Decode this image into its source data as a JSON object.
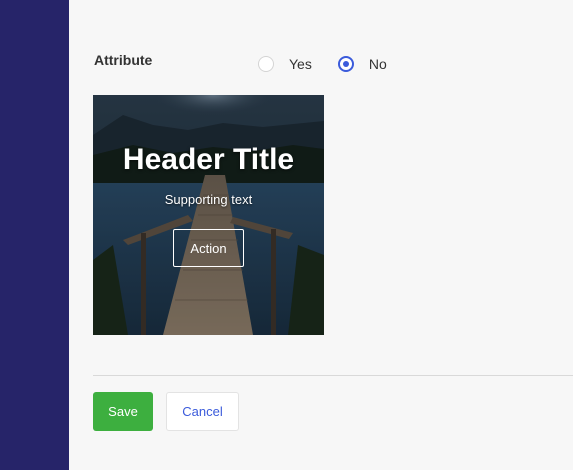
{
  "attribute": {
    "label": "Attribute",
    "options": [
      {
        "label": "Yes",
        "checked": false
      },
      {
        "label": "No",
        "checked": true
      }
    ]
  },
  "card": {
    "title": "Header Title",
    "subtitle": "Supporting text",
    "action_label": "Action"
  },
  "footer": {
    "save_label": "Save",
    "cancel_label": "Cancel"
  },
  "colors": {
    "sidebar": "#262469",
    "accent": "#3b5bdb",
    "save": "#3daf3f"
  }
}
